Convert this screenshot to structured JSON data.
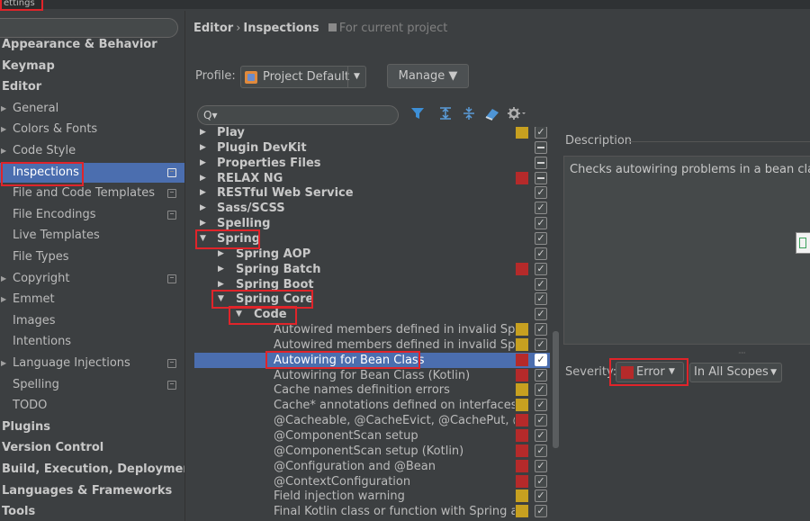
{
  "window": {
    "title": "ettings"
  },
  "sidebar": {
    "items": [
      {
        "label": "Appearance & Behavior",
        "bold": true,
        "indent": 0,
        "arrow": false,
        "project": false
      },
      {
        "label": "Keymap",
        "bold": true,
        "indent": 0,
        "arrow": false,
        "project": false
      },
      {
        "label": "Editor",
        "bold": true,
        "indent": 0,
        "arrow": false,
        "project": false
      },
      {
        "label": "General",
        "bold": false,
        "indent": 1,
        "arrow": true,
        "project": false
      },
      {
        "label": "Colors & Fonts",
        "bold": false,
        "indent": 1,
        "arrow": true,
        "project": false
      },
      {
        "label": "Code Style",
        "bold": false,
        "indent": 1,
        "arrow": true,
        "project": false
      },
      {
        "label": "Inspections",
        "bold": false,
        "indent": 1,
        "arrow": false,
        "project": true,
        "selected": true
      },
      {
        "label": "File and Code Templates",
        "bold": false,
        "indent": 1,
        "arrow": false,
        "project": true
      },
      {
        "label": "File Encodings",
        "bold": false,
        "indent": 1,
        "arrow": false,
        "project": true
      },
      {
        "label": "Live Templates",
        "bold": false,
        "indent": 1,
        "arrow": false,
        "project": false
      },
      {
        "label": "File Types",
        "bold": false,
        "indent": 1,
        "arrow": false,
        "project": false
      },
      {
        "label": "Copyright",
        "bold": false,
        "indent": 1,
        "arrow": true,
        "project": true
      },
      {
        "label": "Emmet",
        "bold": false,
        "indent": 1,
        "arrow": true,
        "project": false
      },
      {
        "label": "Images",
        "bold": false,
        "indent": 1,
        "arrow": false,
        "project": false
      },
      {
        "label": "Intentions",
        "bold": false,
        "indent": 1,
        "arrow": false,
        "project": false
      },
      {
        "label": "Language Injections",
        "bold": false,
        "indent": 1,
        "arrow": true,
        "project": true
      },
      {
        "label": "Spelling",
        "bold": false,
        "indent": 1,
        "arrow": false,
        "project": true
      },
      {
        "label": "TODO",
        "bold": false,
        "indent": 1,
        "arrow": false,
        "project": false
      },
      {
        "label": "Plugins",
        "bold": true,
        "indent": 0,
        "arrow": false,
        "project": false
      },
      {
        "label": "Version Control",
        "bold": true,
        "indent": 0,
        "arrow": true,
        "project": false
      },
      {
        "label": "Build, Execution, Deployment",
        "bold": true,
        "indent": 0,
        "arrow": true,
        "project": false
      },
      {
        "label": "Languages & Frameworks",
        "bold": true,
        "indent": 0,
        "arrow": true,
        "project": false
      },
      {
        "label": "Tools",
        "bold": true,
        "indent": 0,
        "arrow": true,
        "project": false
      }
    ]
  },
  "header": {
    "crumb_editor": "Editor",
    "crumb_sep": "›",
    "crumb_inspections": "Inspections",
    "scope_note": "For current project"
  },
  "profile": {
    "label": "Profile:",
    "value": "Project Default",
    "dropdown_glyph": "▼",
    "manage_label": "Manage ▼"
  },
  "toolbar": {
    "search_glyph": "Q▾"
  },
  "colors": {
    "error": "#b52a2a",
    "warning": "#c7a020",
    "unused": "#6b6b6b",
    "selection": "#4b6eaf",
    "highlight": "#e0242a"
  },
  "inspections": [
    {
      "label": "Play",
      "level": 0,
      "group": true,
      "expanded": false,
      "severity": "warning",
      "check": "checked"
    },
    {
      "label": "Plugin DevKit",
      "level": 0,
      "group": true,
      "expanded": false,
      "severity": "",
      "check": "mixed"
    },
    {
      "label": "Properties Files",
      "level": 0,
      "group": true,
      "expanded": false,
      "severity": "",
      "check": "mixed"
    },
    {
      "label": "RELAX NG",
      "level": 0,
      "group": true,
      "expanded": false,
      "severity": "error",
      "check": "mixed"
    },
    {
      "label": "RESTful Web Service",
      "level": 0,
      "group": true,
      "expanded": false,
      "severity": "",
      "check": "checked"
    },
    {
      "label": "Sass/SCSS",
      "level": 0,
      "group": true,
      "expanded": false,
      "severity": "",
      "check": "checked"
    },
    {
      "label": "Spelling",
      "level": 0,
      "group": true,
      "expanded": false,
      "severity": "",
      "check": "checked"
    },
    {
      "label": "Spring",
      "level": 0,
      "group": true,
      "expanded": true,
      "severity": "",
      "check": "checked"
    },
    {
      "label": "Spring AOP",
      "level": 1,
      "group": true,
      "expanded": false,
      "severity": "",
      "check": "checked"
    },
    {
      "label": "Spring Batch",
      "level": 1,
      "group": true,
      "expanded": false,
      "severity": "error",
      "check": "checked"
    },
    {
      "label": "Spring Boot",
      "level": 1,
      "group": true,
      "expanded": false,
      "severity": "",
      "check": "checked"
    },
    {
      "label": "Spring Core",
      "level": 1,
      "group": true,
      "expanded": true,
      "severity": "",
      "check": "checked"
    },
    {
      "label": "Code",
      "level": 2,
      "group": true,
      "expanded": true,
      "severity": "",
      "check": "checked"
    },
    {
      "label": "Autowired members defined in invalid Spring bean",
      "level": 3,
      "group": false,
      "severity": "warning",
      "check": "checked"
    },
    {
      "label": "Autowired members defined in invalid Spring bean (Kotlin)",
      "level": 3,
      "group": false,
      "severity": "warning",
      "check": "checked"
    },
    {
      "label": "Autowiring for Bean Class",
      "level": 3,
      "group": false,
      "severity": "error",
      "check": "checked",
      "selected": true
    },
    {
      "label": "Autowiring for Bean Class (Kotlin)",
      "level": 3,
      "group": false,
      "severity": "error",
      "check": "checked"
    },
    {
      "label": "Cache names definition errors",
      "level": 3,
      "group": false,
      "severity": "warning",
      "check": "checked"
    },
    {
      "label": "Cache* annotations defined on interfaces/interface methods",
      "level": 3,
      "group": false,
      "severity": "warning",
      "check": "checked"
    },
    {
      "label": "@Cacheable, @CacheEvict, @CachePut, @CacheConfig",
      "level": 3,
      "group": false,
      "severity": "error",
      "check": "checked"
    },
    {
      "label": "@ComponentScan setup",
      "level": 3,
      "group": false,
      "severity": "error",
      "check": "checked"
    },
    {
      "label": "@ComponentScan setup (Kotlin)",
      "level": 3,
      "group": false,
      "severity": "error",
      "check": "checked"
    },
    {
      "label": "@Configuration and @Bean",
      "level": 3,
      "group": false,
      "severity": "error",
      "check": "checked"
    },
    {
      "label": "@ContextConfiguration",
      "level": 3,
      "group": false,
      "severity": "error",
      "check": "checked"
    },
    {
      "label": "Field injection warning",
      "level": 3,
      "group": false,
      "severity": "warning",
      "check": "checked"
    },
    {
      "label": "Final Kotlin class or function with Spring annotation",
      "level": 3,
      "group": false,
      "severity": "warning",
      "check": "checked"
    }
  ],
  "description": {
    "title": "Description",
    "text": "Checks autowiring problems in a bean class."
  },
  "severity": {
    "label": "Severity:",
    "value": "Error",
    "dropdown_glyph": "▼",
    "scope_value": "In All Scopes",
    "scope_glyph": "▼"
  }
}
